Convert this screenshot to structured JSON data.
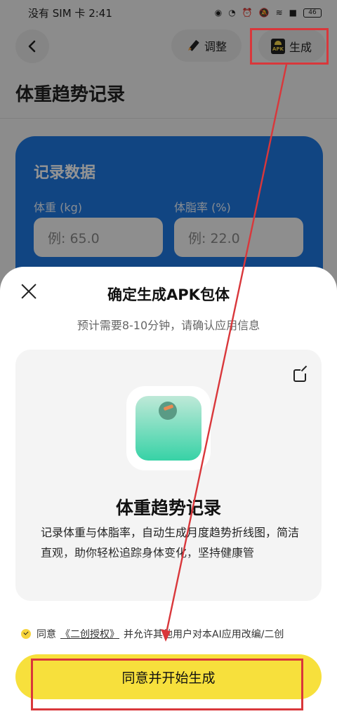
{
  "status": {
    "left": "没有 SIM 卡 2:41",
    "battery": "46"
  },
  "header": {
    "adjust_label": "调整",
    "generate_label": "生成",
    "apk_text": "APK"
  },
  "page": {
    "title": "体重趋势记录"
  },
  "record_card": {
    "heading": "记录数据",
    "weight_label": "体重 (kg)",
    "weight_placeholder": "例: 65.0",
    "fat_label": "体脂率 (%)",
    "fat_placeholder": "例: 22.0"
  },
  "sheet": {
    "title": "确定生成APK包体",
    "subtitle": "预计需要8-10分钟，请确认应用信息",
    "app_name": "体重趋势记录",
    "app_description": "记录体重与体脂率，自动生成月度趋势折线图，简洁直观，助你轻松追踪身体变化，坚持健康管",
    "agree_prefix": "同意",
    "agree_link": "《二创授权》",
    "agree_suffix": "并允许其他用户对本AI应用改编/二创",
    "start_label": "同意并开始生成"
  },
  "colors": {
    "accent_yellow": "#f7e03c",
    "card_blue": "#1e77e0",
    "annotation_red": "#d9373b",
    "icon_green": "#37d2a6"
  },
  "icons": [
    "back-arrow-icon",
    "pencil-icon",
    "apk-icon",
    "close-icon",
    "edit-icon",
    "scale-icon",
    "checkbox-icon"
  ]
}
